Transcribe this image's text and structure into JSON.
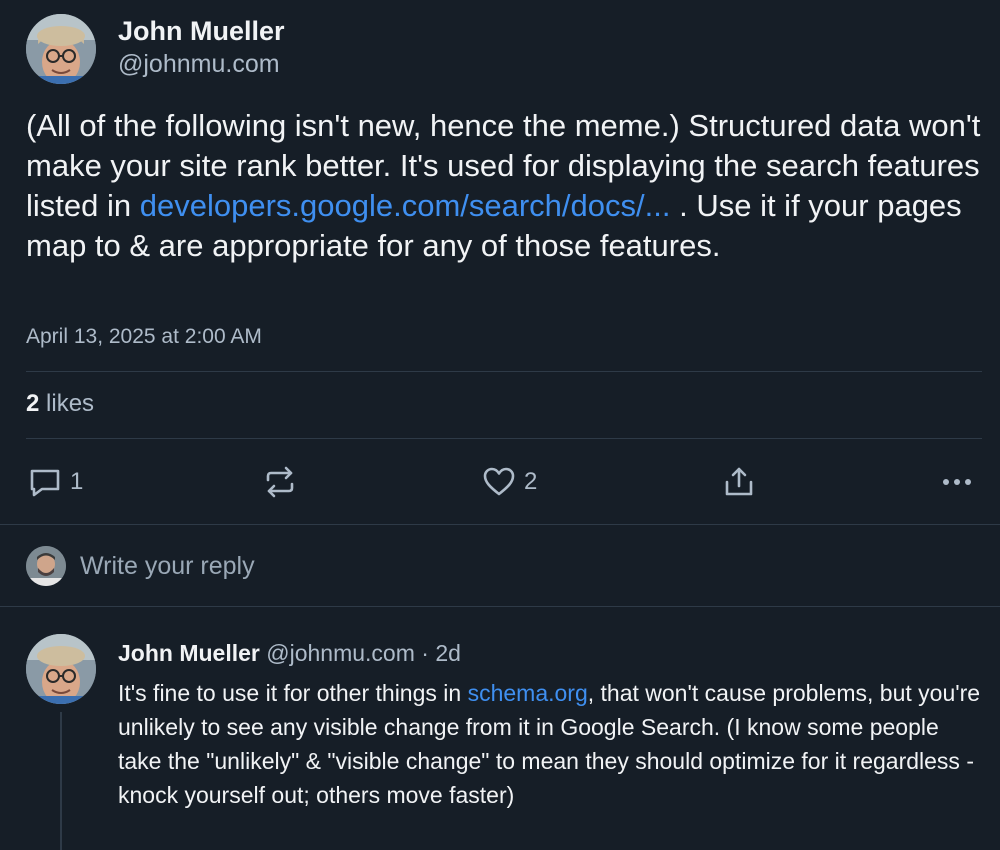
{
  "post": {
    "author_name": "John Mueller",
    "author_handle": "@johnmu.com",
    "text_before_link": "(All of the following isn't new, hence the meme.) Structured data won't make your site rank better. It's used for displaying the search features listed in ",
    "link_text": "developers.google.com/search/docs/...",
    "text_after_link": " . Use it if your pages map to & are appropriate for any of those features.",
    "timestamp": "April 13, 2025 at 2:00 AM",
    "likes_count": "2",
    "likes_label": " likes"
  },
  "actions": {
    "reply_count": "1",
    "like_count": "2",
    "icons": [
      "reply-icon",
      "repost-icon",
      "heart-icon",
      "share-icon",
      "more-icon"
    ]
  },
  "compose": {
    "placeholder": "Write your reply"
  },
  "reply": {
    "author_name": "John Mueller",
    "author_handle": "@johnmu.com",
    "separator": " · ",
    "age": "2d",
    "text_before_link": "It's fine to use it for other things in ",
    "link_text": "schema.org",
    "text_after_link": ", that won't cause problems, but you're unlikely to see any visible change from it in Google Search. (I know some people take the \"unlikely\" & \"visible change\" to mean they should optimize for it regardless - knock yourself out; others move faster)"
  },
  "colors": {
    "background": "#161e27",
    "text": "#f1f3f5",
    "muted": "#aebbc9",
    "link": "#3f8ff0",
    "divider": "#2e3a47"
  }
}
